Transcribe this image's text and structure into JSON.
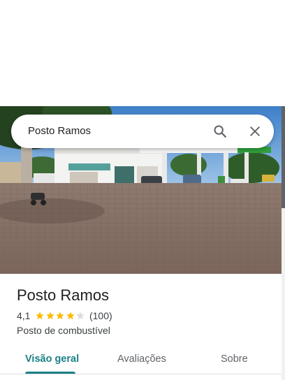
{
  "search": {
    "query": "Posto Ramos",
    "search_icon": "search-icon",
    "close_icon": "close-icon"
  },
  "place": {
    "name": "Posto Ramos",
    "rating": "4,1",
    "rating_value": 4.1,
    "stars_max": 5,
    "reviews": "(100)",
    "category": "Posto de combustível"
  },
  "tabs": [
    {
      "label": "Visão geral",
      "selected": true
    },
    {
      "label": "Avaliações",
      "selected": false
    },
    {
      "label": "Sobre",
      "selected": false
    }
  ],
  "colors": {
    "accent": "#1a7f86",
    "star": "#fbbc04",
    "star_empty": "#dadce0"
  }
}
